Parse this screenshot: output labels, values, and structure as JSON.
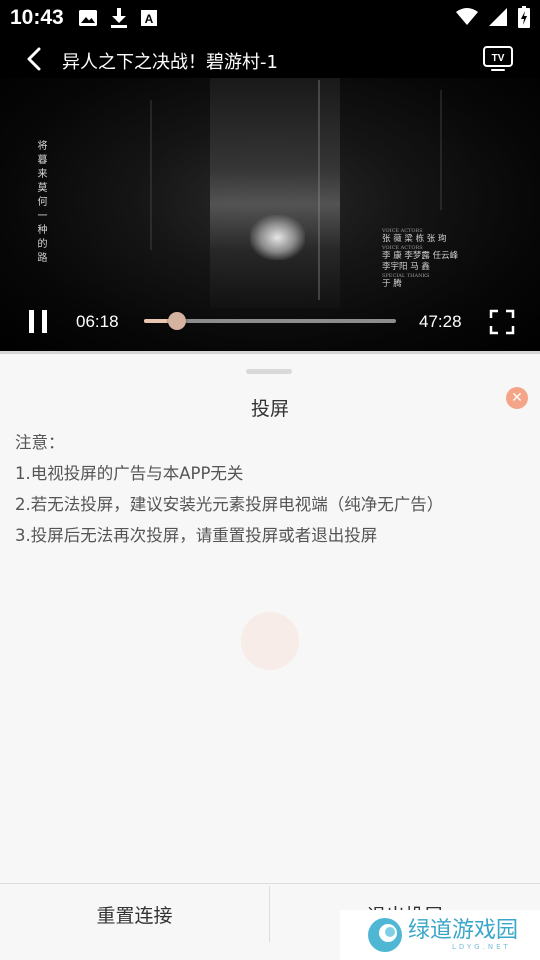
{
  "status_bar": {
    "time": "10:43",
    "left_icons": [
      "image-icon",
      "download-icon",
      "a-box-icon"
    ],
    "right_icons": [
      "wifi-icon",
      "signal-icon",
      "battery-charging-icon"
    ]
  },
  "header": {
    "title": "异人之下之决战！碧游村-1",
    "back_icon": "back-chevron-icon",
    "cast_icon": "tv-cast-icon"
  },
  "video": {
    "subtitle_vertical": "将暮来莫何一种的路",
    "credits_title_small": "VOICE ACTORS",
    "credits_lines": [
      "张 薇  梁 栋  张 珣",
      "李 康  李梦露  任云峰",
      "李宇阳  马 鑫",
      "于 腾"
    ],
    "credits_line_small_2": "VOICE ACTORS",
    "credits_line_small_4": "SPECIAL THANKS"
  },
  "player": {
    "current_time": "06:18",
    "total_time": "47:28",
    "progress": 0.1327,
    "accent_color": "#d6b3a0"
  },
  "sheet": {
    "title": "投屏",
    "close_icon": "close-x-icon",
    "notice_lines": [
      "注意：",
      "1.电视投屏的广告与本APP无关",
      "2.若无法投屏，建议安装光元素投屏电视端（纯净无广告）",
      "3.投屏后无法再次投屏，请重置投屏或者退出投屏"
    ],
    "close_color": "#f4a487"
  },
  "footer": {
    "reset_label": "重置连接",
    "exit_label": "退出投屏"
  },
  "watermark": {
    "text": "绿道游戏园",
    "sub": "LDYG.NET"
  }
}
